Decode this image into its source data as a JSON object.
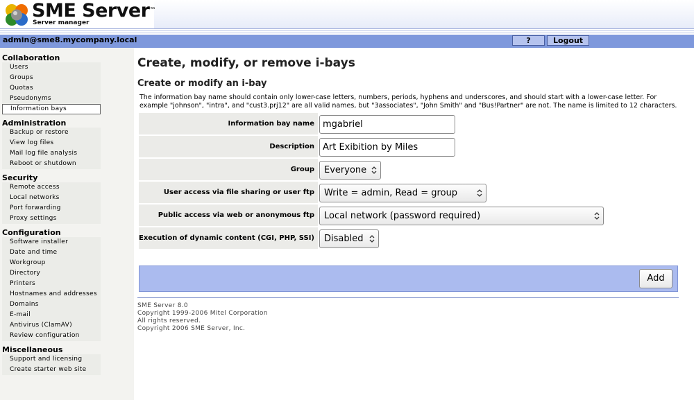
{
  "header": {
    "brand": "SME Server",
    "trademark": "™",
    "subtitle": "Server manager"
  },
  "topbar": {
    "user": "admin@sme8.mycompany.local",
    "help_label": "?",
    "logout_label": "Logout"
  },
  "sidebar": {
    "sections": [
      {
        "title": "Collaboration",
        "items": [
          "Users",
          "Groups",
          "Quotas",
          "Pseudonyms",
          "Information bays"
        ]
      },
      {
        "title": "Administration",
        "items": [
          "Backup or restore",
          "View log files",
          "Mail log file analysis",
          "Reboot or shutdown"
        ]
      },
      {
        "title": "Security",
        "items": [
          "Remote access",
          "Local networks",
          "Port forwarding",
          "Proxy settings"
        ]
      },
      {
        "title": "Configuration",
        "items": [
          "Software installer",
          "Date and time",
          "Workgroup",
          "Directory",
          "Printers",
          "Hostnames and addresses",
          "Domains",
          "E-mail",
          "Antivirus (ClamAV)",
          "Review configuration"
        ]
      },
      {
        "title": "Miscellaneous",
        "items": [
          "Support and licensing",
          "Create starter web site"
        ]
      }
    ],
    "active_item": "Information bays"
  },
  "main": {
    "title": "Create, modify, or remove i-bays",
    "subtitle": "Create or modify an i-bay",
    "description": "The information bay name should contain only lower-case letters, numbers, periods, hyphens and underscores, and should start with a lower-case letter. For example \"johnson\", \"intra\", and \"cust3.prj12\" are all valid names, but \"3associates\", \"John Smith\" and \"Bus!Partner\" are not. The name is limited to 12 characters.",
    "fields": {
      "name": {
        "label": "Information bay name",
        "value": "mgabriel"
      },
      "description": {
        "label": "Description",
        "value": "Art Exibition by Miles"
      },
      "group": {
        "label": "Group",
        "value": "Everyone"
      },
      "user_access": {
        "label": "User access via file sharing or user ftp",
        "value": "Write = admin, Read = group"
      },
      "public_access": {
        "label": "Public access via web or anonymous ftp",
        "value": "Local network (password required)"
      },
      "dynamic_content": {
        "label": "Execution of dynamic content (CGI, PHP, SSI)",
        "value": "Disabled"
      }
    },
    "add_label": "Add"
  },
  "footer": {
    "lines": [
      "SME Server 8.0",
      "Copyright 1999-2006 Mitel Corporation",
      "All rights reserved.",
      "Copyright 2006 SME Server, Inc."
    ]
  },
  "colors": {
    "topbar": "#7e98dc",
    "action_bar": "#abbbef",
    "sidebar": "#f3f3f0",
    "label_cell": "#ebebe8"
  }
}
